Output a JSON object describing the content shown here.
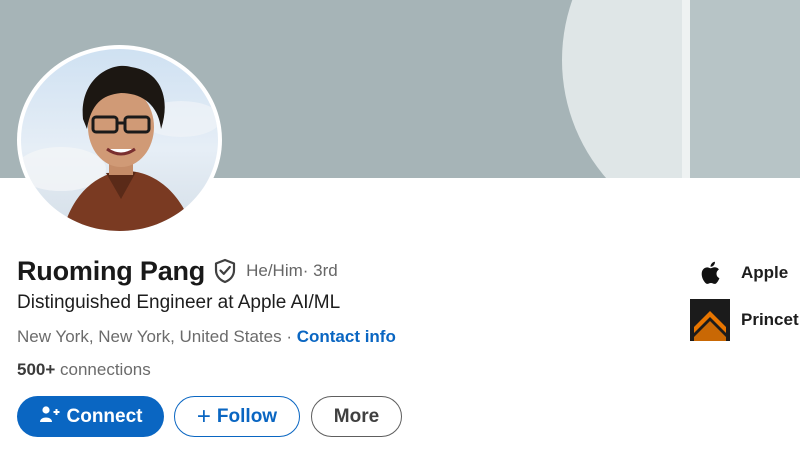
{
  "profile": {
    "name": "Ruoming Pang",
    "pronouns": "He/Him",
    "degree": " · 3rd",
    "headline": "Distinguished Engineer at Apple AI/ML",
    "location": "New York, New York, United States",
    "separator": " · ",
    "contact_link": "Contact info",
    "connections_count": "500+",
    "connections_label": " connections"
  },
  "actions": {
    "connect_label": "Connect",
    "follow_label": "Follow",
    "follow_icon": "+",
    "more_label": "More"
  },
  "sidebar": {
    "items": [
      {
        "label": "Apple",
        "icon": "apple-logo-icon"
      },
      {
        "label": "Princet",
        "icon": "princeton-logo-icon"
      }
    ]
  },
  "colors": {
    "accent": "#0a66c2",
    "cover": "#a6b4b7",
    "princeton_orange": "#e77500"
  }
}
